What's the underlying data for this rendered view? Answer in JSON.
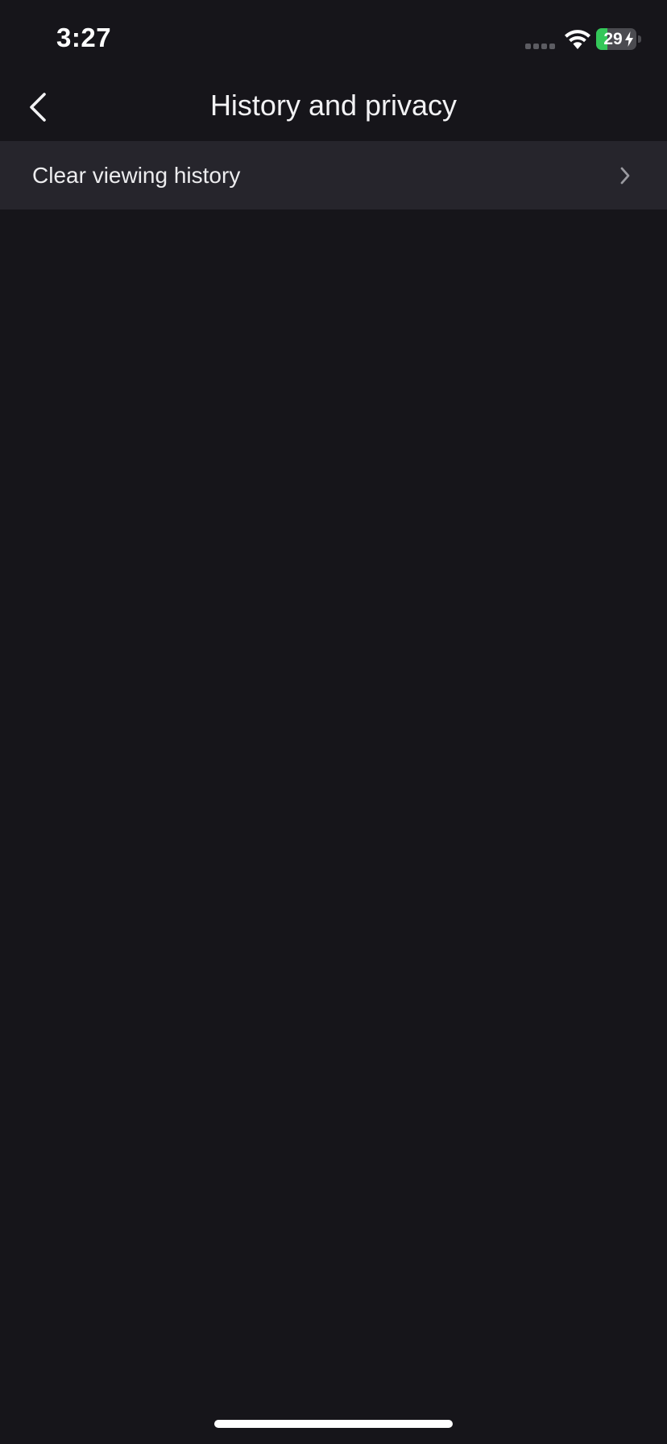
{
  "status_bar": {
    "time": "3:27",
    "battery_level": "29",
    "battery_fraction": 0.29,
    "battery_color": "#34c759",
    "icons": [
      "signal-icon",
      "wifi-icon",
      "battery-charging-icon"
    ]
  },
  "nav": {
    "title": "History and privacy",
    "back_icon": "chevron-left-icon"
  },
  "settings": {
    "items": [
      {
        "label": "Clear viewing history",
        "icon": "chevron-right-icon"
      }
    ]
  },
  "colors": {
    "background": "#16151a",
    "row_background": "#26252c",
    "text": "#f2f2f4"
  }
}
